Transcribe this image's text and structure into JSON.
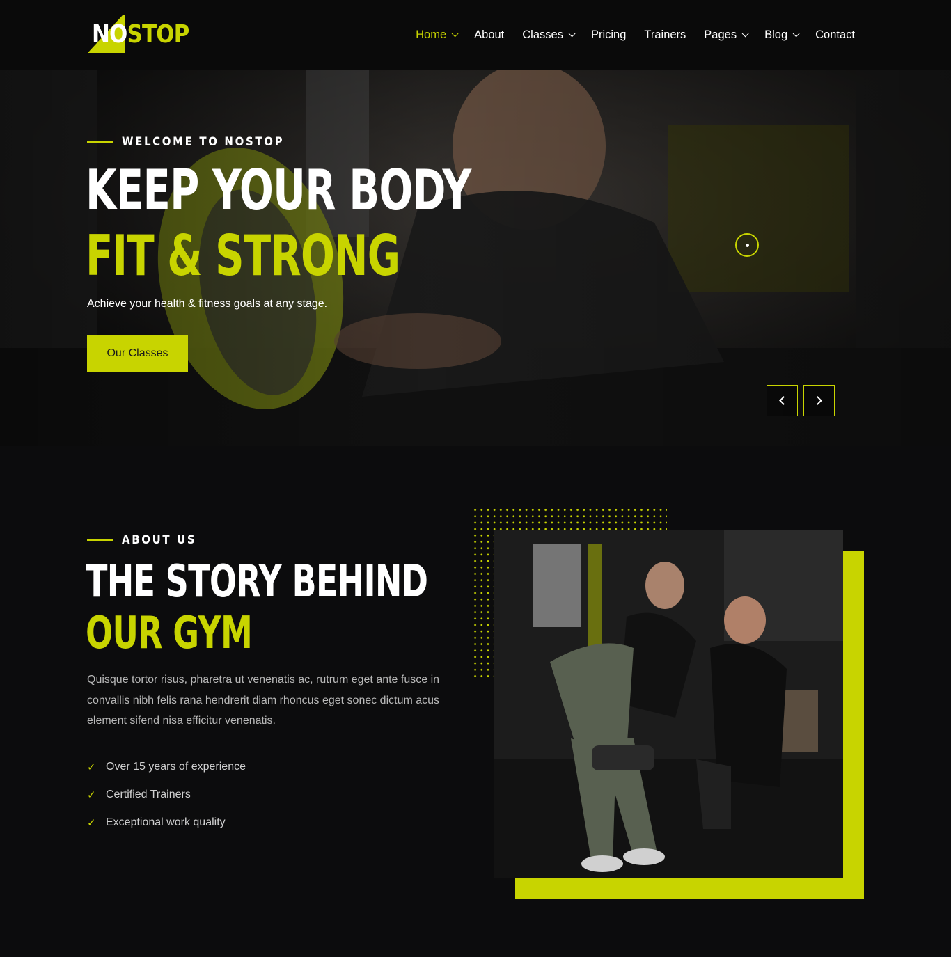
{
  "brand": {
    "logo_no": "NO",
    "logo_stop": "STOP",
    "accent": "#c8d400"
  },
  "nav": [
    {
      "label": "Home",
      "dropdown": true,
      "active": true
    },
    {
      "label": "About",
      "dropdown": false
    },
    {
      "label": "Classes",
      "dropdown": true
    },
    {
      "label": "Pricing",
      "dropdown": false
    },
    {
      "label": "Trainers",
      "dropdown": false
    },
    {
      "label": "Pages",
      "dropdown": true
    },
    {
      "label": "Blog",
      "dropdown": true
    },
    {
      "label": "Contact",
      "dropdown": false
    }
  ],
  "hero": {
    "eyebrow": "WELCOME TO NOSTOP",
    "title_line1": "KEEP YOUR BODY",
    "title_line2": "FIT & STRONG",
    "subtitle": "Achieve your health & fitness goals at any stage.",
    "cta_label": "Our Classes",
    "prev_icon": "chevron-left-icon",
    "next_icon": "chevron-right-icon"
  },
  "about": {
    "eyebrow": "ABOUT US",
    "title_line1": "THE STORY BEHIND",
    "title_line2": "OUR GYM",
    "description": "Quisque tortor risus, pharetra ut venenatis ac, rutrum eget ante fusce in convallis nibh felis rana hendrerit diam rhoncus eget sonec dictum acus element sifend nisa efficitur venenatis.",
    "features": [
      "Over 15 years of experience",
      "Certified Trainers",
      "Exceptional work quality"
    ],
    "check_icon": "check-icon"
  }
}
